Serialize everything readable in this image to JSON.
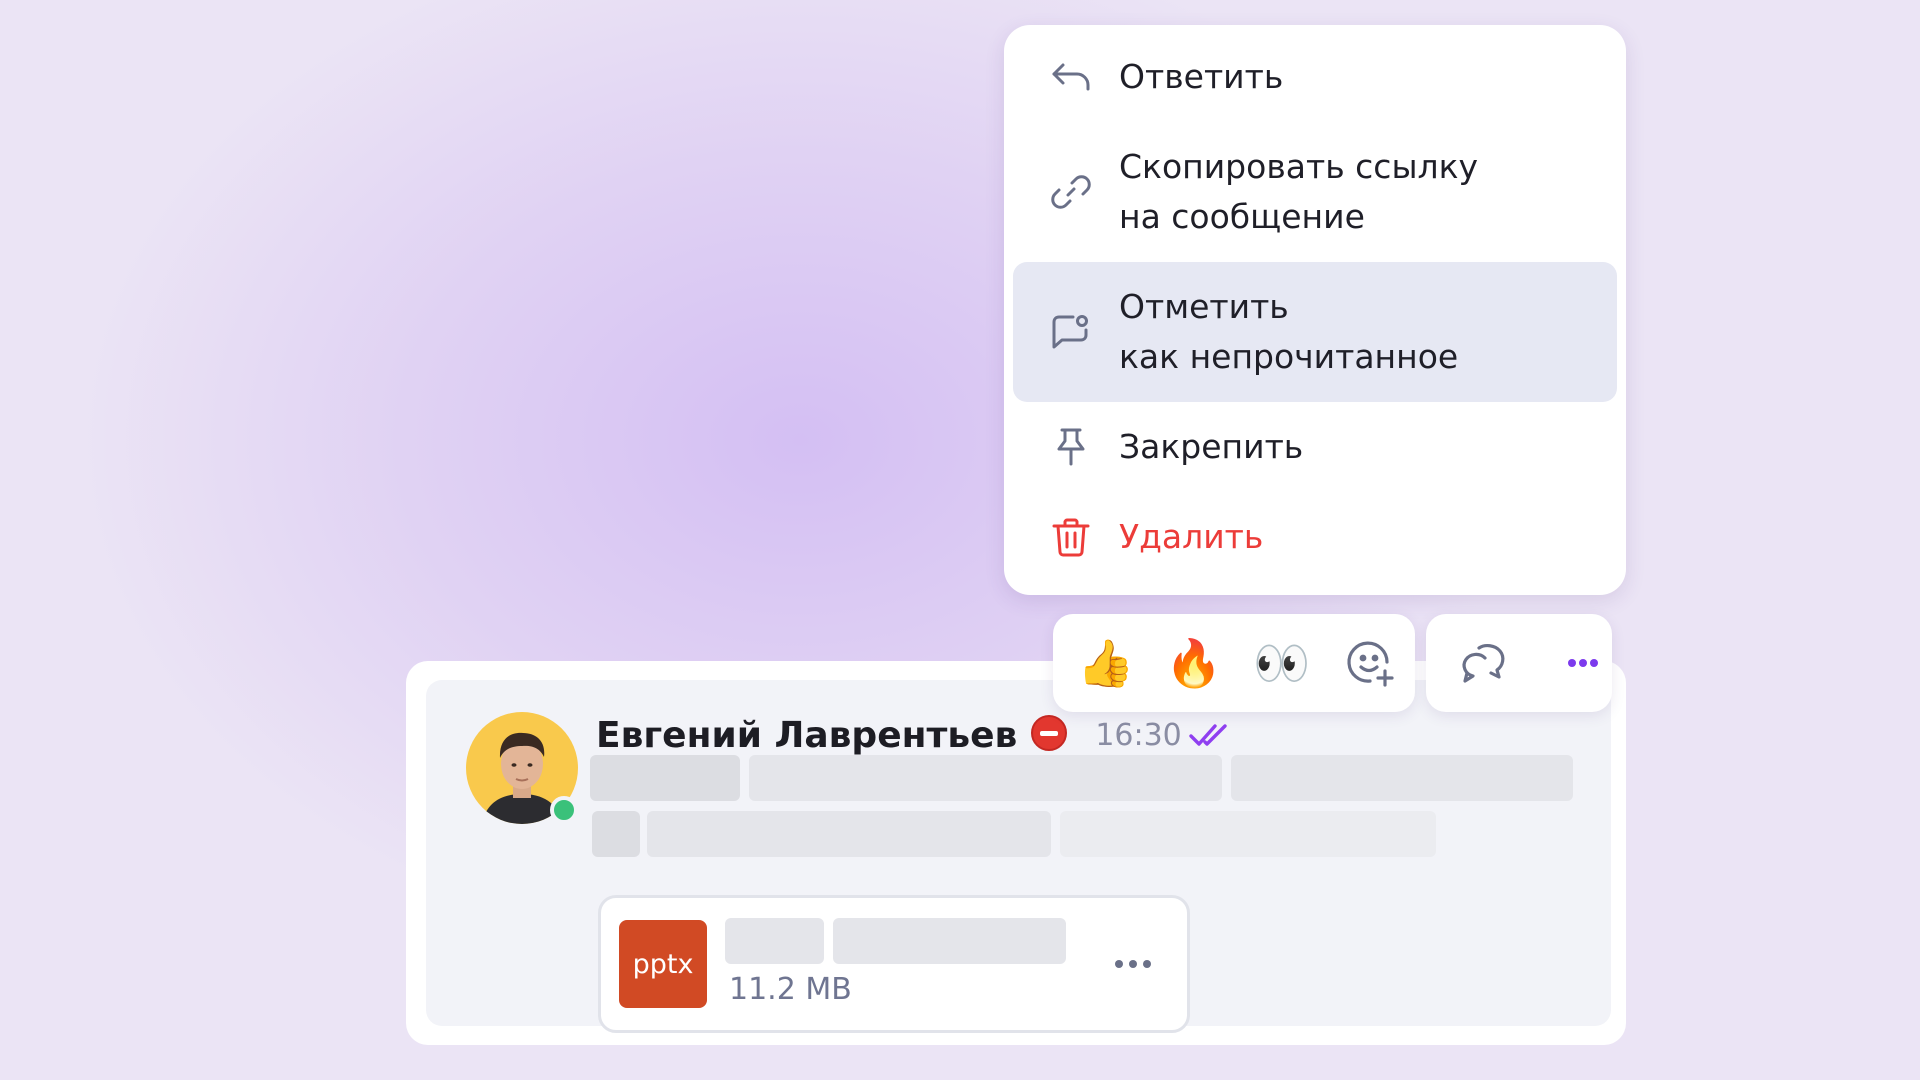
{
  "context_menu": {
    "items": [
      {
        "label": "Ответить",
        "icon": "reply-icon"
      },
      {
        "label": "Скопировать ссылку\nна сообщение",
        "icon": "link-icon"
      },
      {
        "label": "Отметить\nкак непрочитанное",
        "icon": "mark-unread-icon",
        "highlighted": true
      },
      {
        "label": "Закрепить",
        "icon": "pin-icon"
      },
      {
        "label": "Удалить",
        "icon": "trash-icon",
        "danger": true
      }
    ]
  },
  "reactions": {
    "quick": [
      "👍",
      "🔥",
      "👀"
    ],
    "add_icon": "add-reaction-icon",
    "thread_icon": "thread-icon",
    "more_icon": "more-icon"
  },
  "message": {
    "author": "Евгений Лаврентьев",
    "time": "16:30",
    "online": true,
    "status": "do-not-disturb",
    "read": true,
    "attachment": {
      "type": "pptx",
      "size": "11.2 MB"
    }
  },
  "colors": {
    "accent": "#7c3aed",
    "danger": "#ec3c39",
    "online": "#3ac17a",
    "file_pptx": "#d14a24"
  }
}
